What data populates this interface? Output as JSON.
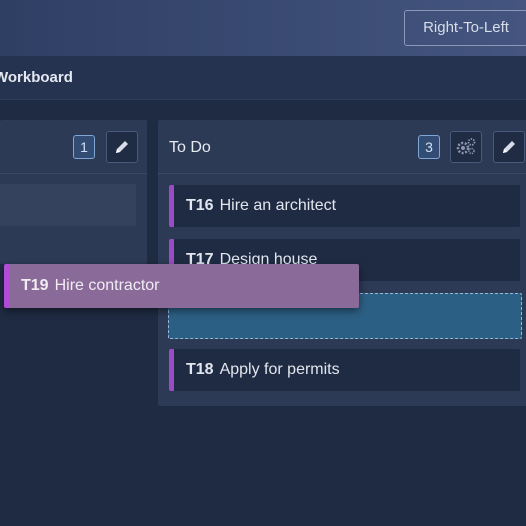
{
  "header": {
    "rtl_button_label": "Right-To-Left"
  },
  "board": {
    "title": "Workboard"
  },
  "lanes": [
    {
      "title": "",
      "count": "1"
    },
    {
      "title": "To Do",
      "count": "3",
      "cards": [
        {
          "id": "T16",
          "title": "Hire an architect"
        },
        {
          "id": "T17",
          "title": "Design house"
        },
        {
          "id": "T18",
          "title": "Apply for permits"
        }
      ]
    }
  ],
  "dragging_card": {
    "id": "T19",
    "title": "Hire contractor"
  },
  "colors": {
    "accent_purple": "#9b4cc4",
    "drop_zone": "#2c5f84",
    "badge_border": "#7fa7d6"
  },
  "icons": [
    "pencil-icon",
    "gear-icon"
  ]
}
